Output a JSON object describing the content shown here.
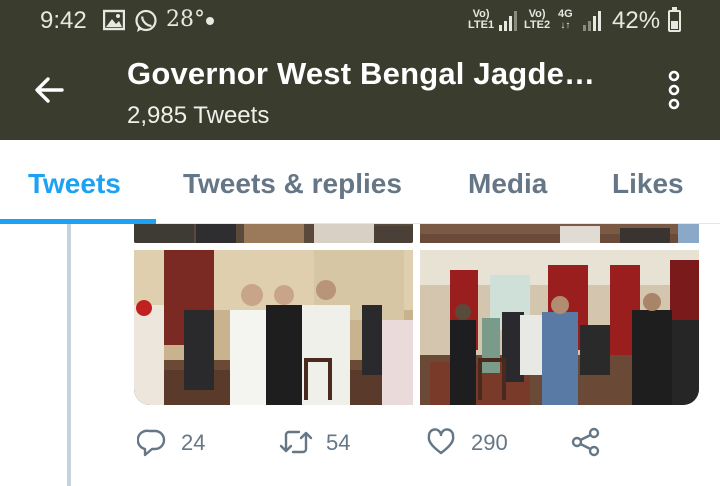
{
  "status_bar": {
    "time": "9:42",
    "temperature": "28°",
    "sim1": {
      "top": "Vo)",
      "bottom": "LTE1"
    },
    "sim2": {
      "top": "Vo)",
      "bottom": "LTE2"
    },
    "net_type": "4G",
    "battery": "42%",
    "icons": [
      "gallery-icon",
      "whatsapp-icon",
      "signal-icon",
      "battery-icon"
    ]
  },
  "header": {
    "title": "Governor West Bengal Jagde…",
    "subtitle": "2,985 Tweets",
    "background": "#3a3c2e"
  },
  "tabs": [
    {
      "label": "Tweets",
      "active": true
    },
    {
      "label": "Tweets & replies",
      "active": false
    },
    {
      "label": "Media",
      "active": false
    },
    {
      "label": "Likes",
      "active": false
    }
  ],
  "accent_color": "#1da1f2",
  "tweet": {
    "actions": {
      "replies": "24",
      "retweets": "54",
      "likes": "290"
    }
  }
}
